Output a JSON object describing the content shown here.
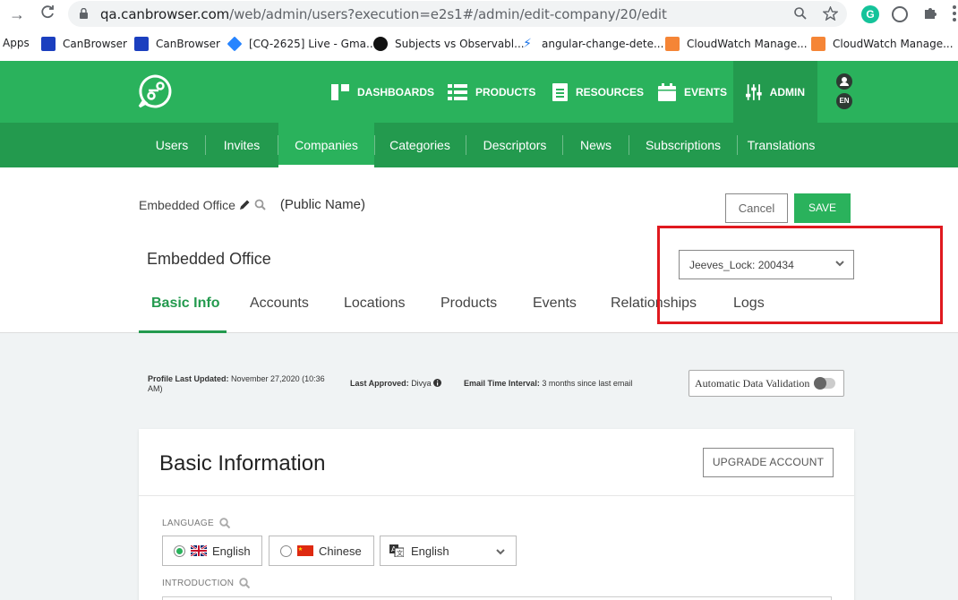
{
  "browser": {
    "url_host": "qa.canbrowser.com",
    "url_path": "/web/admin/users?execution=e2s1#/admin/edit-company/20/edit",
    "bookmarks": [
      {
        "label": "Apps"
      },
      {
        "label": "CanBrowser"
      },
      {
        "label": "CanBrowser"
      },
      {
        "label": "[CQ-2625] Live - Gma..."
      },
      {
        "label": "Subjects vs Observabl..."
      },
      {
        "label": "angular-change-dete..."
      },
      {
        "label": "CloudWatch Manage..."
      },
      {
        "label": "CloudWatch Manage..."
      }
    ]
  },
  "topnav": {
    "items": [
      {
        "label": "DASHBOARDS",
        "icon": "dashboards-icon"
      },
      {
        "label": "PRODUCTS",
        "icon": "products-icon"
      },
      {
        "label": "RESOURCES",
        "icon": "resources-icon"
      },
      {
        "label": "EVENTS",
        "icon": "calendar-icon"
      },
      {
        "label": "ADMIN",
        "icon": "sliders-icon"
      }
    ],
    "lang": "EN"
  },
  "subnav": {
    "items": [
      "Users",
      "Invites",
      "Companies",
      "Categories",
      "Descriptors",
      "News",
      "Subscriptions",
      "Translations"
    ],
    "active": "Companies"
  },
  "company": {
    "public_name": "Embedded Office",
    "public_name_label": "(Public Name)",
    "title": "Embedded Office",
    "lock_value": "Jeeves_Lock: 200434",
    "cancel_label": "Cancel",
    "save_label": "SAVE"
  },
  "tabs": [
    "Basic Info",
    "Accounts",
    "Locations",
    "Products",
    "Events",
    "Relationships",
    "Logs"
  ],
  "meta": {
    "profile_label": "Profile Last Updated:",
    "profile_value": "November 27,2020 (10:36",
    "profile_value2": "AM)",
    "approved_label": "Last Approved:",
    "approved_value": "Divya",
    "interval_label": "Email Time Interval:",
    "interval_value": "3 months since last email",
    "auto_validation": "Automatic Data Validation"
  },
  "basic": {
    "title": "Basic Information",
    "upgrade_label": "UPGRADE ACCOUNT",
    "language_label": "LANGUAGE",
    "lang_english": "English",
    "lang_chinese": "Chinese",
    "lang_select": "English",
    "intro_label": "INTRODUCTION"
  },
  "colors": {
    "brand_green": "#2ab25c",
    "dark_green": "#239a4e",
    "highlight_red": "#e0191f"
  }
}
